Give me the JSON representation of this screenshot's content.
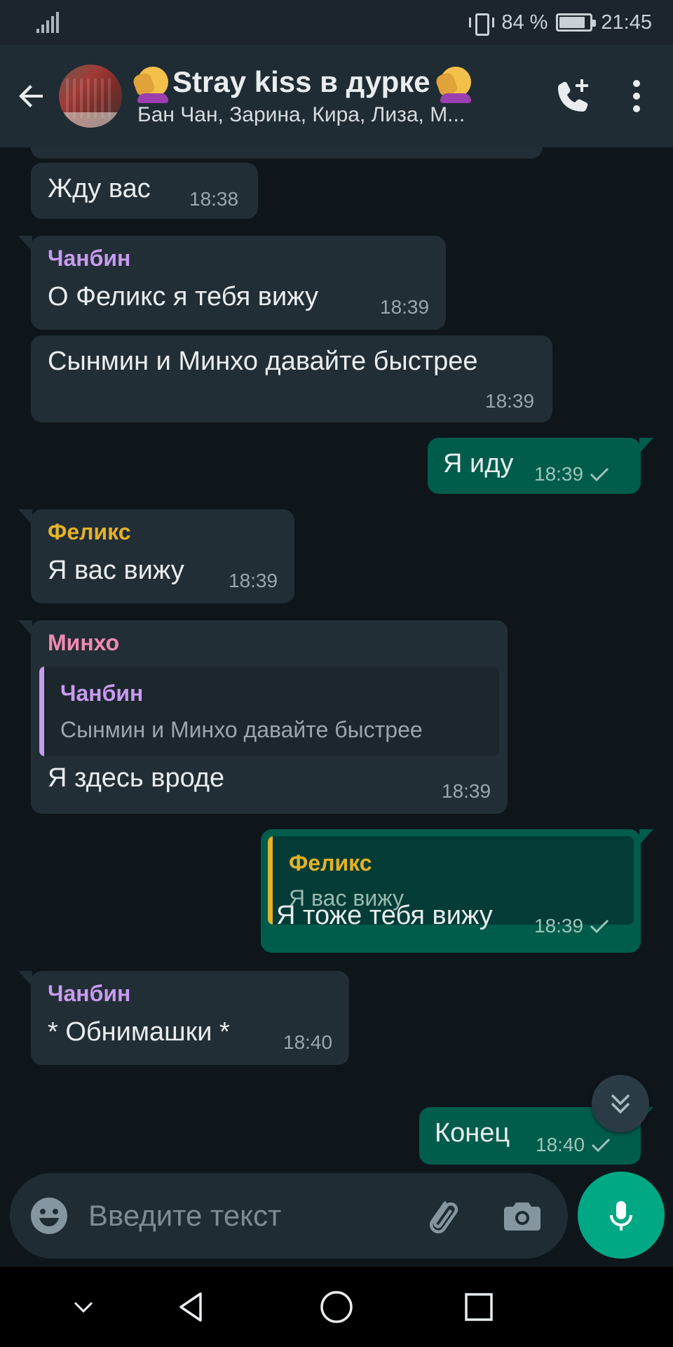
{
  "status_bar": {
    "battery_text": "84 %",
    "battery_level": 0.84,
    "time": "21:45"
  },
  "header": {
    "title": "Stray kiss в дурке",
    "subtitle": "Бан Чан, Зарина, Кира, Лиза, М..."
  },
  "colors": {
    "incoming_bubble": "#222e35",
    "outgoing_bubble": "#005c4b",
    "changbin": "#c79bf0",
    "felix": "#e5b228",
    "minho": "#f18ab3",
    "accent": "#00a884"
  },
  "messages": [
    {
      "type": "incoming",
      "text": "Жду вас",
      "time": "18:38"
    },
    {
      "type": "incoming",
      "sender": "Чанбин",
      "text": "О Феликс я тебя вижу",
      "time": "18:39"
    },
    {
      "type": "incoming",
      "text": "Сынмин и Минхо давайте быстрее",
      "time": "18:39"
    },
    {
      "type": "outgoing",
      "text": "Я иду",
      "time": "18:39"
    },
    {
      "type": "incoming",
      "sender": "Феликс",
      "text": "Я вас вижу",
      "time": "18:39"
    },
    {
      "type": "incoming",
      "sender": "Минхо",
      "quote": {
        "name": "Чанбин",
        "text": "Сынмин и Минхо давайте быстрее"
      },
      "text": "Я здесь вроде",
      "time": "18:39"
    },
    {
      "type": "outgoing",
      "quote": {
        "name": "Феликс",
        "text": "Я вас вижу"
      },
      "text": "Я тоже тебя вижу",
      "time": "18:39"
    },
    {
      "type": "incoming",
      "sender": "Чанбин",
      "text": "* Обнимашки *",
      "time": "18:40"
    },
    {
      "type": "outgoing",
      "text": "Конец",
      "time": "18:40"
    }
  ],
  "composer": {
    "placeholder": "Введите текст"
  },
  "icons": {
    "back": "arrow-left-icon",
    "call": "add-call-icon",
    "menu": "more-vert-icon",
    "emoji": "emoji-icon",
    "attach": "paperclip-icon",
    "camera": "camera-icon",
    "mic": "microphone-icon",
    "scroll": "double-chevron-down-icon"
  }
}
